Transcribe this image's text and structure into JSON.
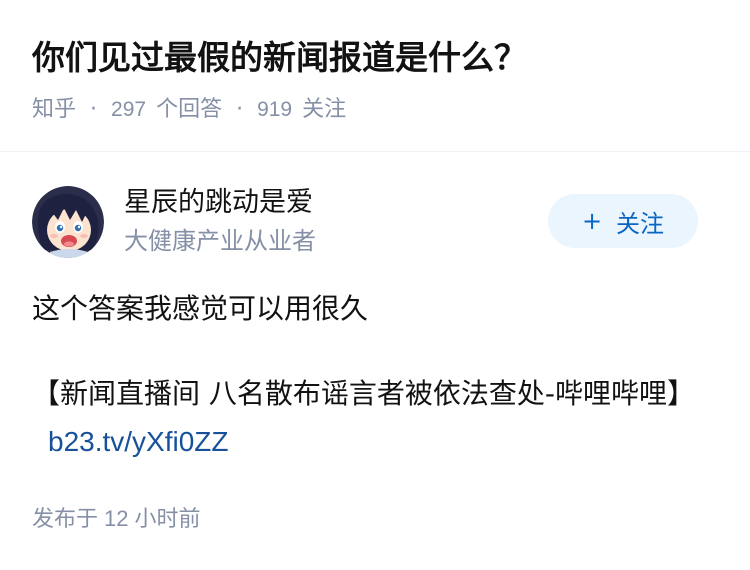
{
  "question": {
    "title": "你们见过最假的新闻报道是什么？",
    "source": "知乎",
    "separator": "·",
    "answers_count": "297",
    "answers_label": "个回答",
    "followers_count": "919",
    "followers_label": "关注"
  },
  "author": {
    "name": "星辰的跳动是爱",
    "headline": "大健康产业从业者",
    "avatar_icon": "anime-girl-avatar",
    "follow_plus": "+",
    "follow_label": "关注"
  },
  "answer": {
    "paragraph_1": "这个答案我感觉可以用很久",
    "paragraph_2_text": "【新闻直播间 八名散布谣言者被依法查处-哔哩哔哩】",
    "paragraph_2_link": "b23.tv/yXfi0ZZ",
    "published_prefix": "发布于",
    "published_number": "12",
    "published_suffix": "小时前"
  },
  "colors": {
    "text": "#121212",
    "meta": "#8590a6",
    "link": "#175199",
    "button_bg": "#ebf5fd",
    "button_text": "#0a66c2"
  }
}
